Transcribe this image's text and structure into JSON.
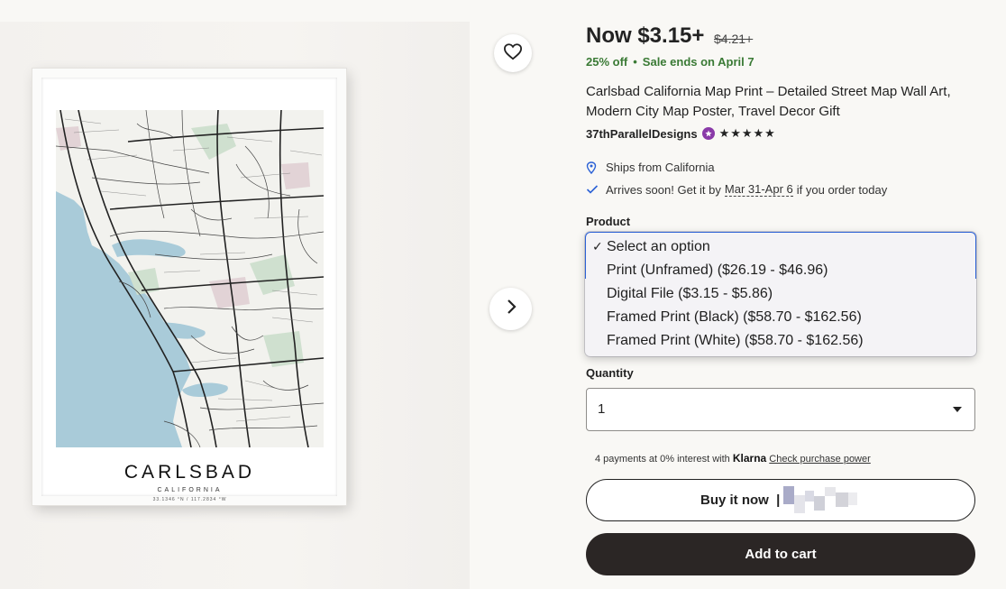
{
  "product": {
    "price_now": "Now $3.15+",
    "price_old": "$4.21+",
    "discount": "25% off",
    "sale_ends": "Sale ends on April 7",
    "title": "Carlsbad California Map Print – Detailed Street Map Wall Art, Modern City Map Poster, Travel Decor Gift",
    "shop_name": "37thParallelDesigns",
    "stars": "★★★★★",
    "ships_from": "Ships from California",
    "arrives_pre": "Arrives soon! Get it by",
    "arrives_dates": "Mar 31-Apr 6",
    "arrives_post": "if you order today"
  },
  "poster": {
    "city": "CARLSBAD",
    "state": "CALIFORNIA",
    "coords": "33.1346 °N / 117.2834 °W"
  },
  "options": {
    "product_label": "Product",
    "product_items": [
      {
        "label": "Select an option",
        "selected": true
      },
      {
        "label": "Print (Unframed) ($26.19 - $46.96)",
        "selected": false
      },
      {
        "label": "Digital File ($3.15 - $5.86)",
        "selected": false
      },
      {
        "label": "Framed Print (Black) ($58.70 - $162.56)",
        "selected": false
      },
      {
        "label": "Framed Print (White) ($58.70 - $162.56)",
        "selected": false
      }
    ],
    "checkmark": "✓",
    "quantity_label": "Quantity",
    "quantity_value": "1"
  },
  "klarna": {
    "text": "4 payments at 0% interest with",
    "brand": "Klarna",
    "link": "Check purchase power"
  },
  "actions": {
    "buy_now": "Buy it now",
    "buy_sep": "|",
    "add_to_cart": "Add to cart"
  },
  "colors": {
    "sale_green": "#3a7a35",
    "focus_blue": "#2c62d6",
    "cart_button": "#2b2625",
    "star_seller_purple": "#8a3aa8"
  }
}
